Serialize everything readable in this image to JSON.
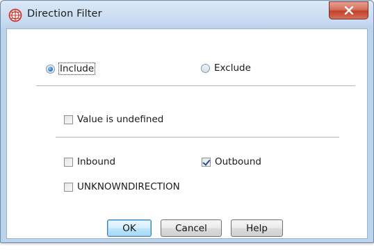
{
  "window": {
    "title": "Direction Filter"
  },
  "icons": {
    "app": "globe-app-icon",
    "close": "close-icon"
  },
  "mode": {
    "include_label": "Include",
    "exclude_label": "Exclude",
    "selected": "Include"
  },
  "undefined_option": {
    "label": "Value is undefined",
    "checked": false
  },
  "directions": [
    {
      "label": "Inbound",
      "checked": false
    },
    {
      "label": "Outbound",
      "checked": true
    },
    {
      "label": "UNKNOWNDIRECTION",
      "checked": false
    }
  ],
  "buttons": {
    "ok": "OK",
    "cancel": "Cancel",
    "help": "Help"
  },
  "colors": {
    "close_button": "#c7432c",
    "default_button_border": "#3c7fb1",
    "app_icon": "#d0312d"
  }
}
